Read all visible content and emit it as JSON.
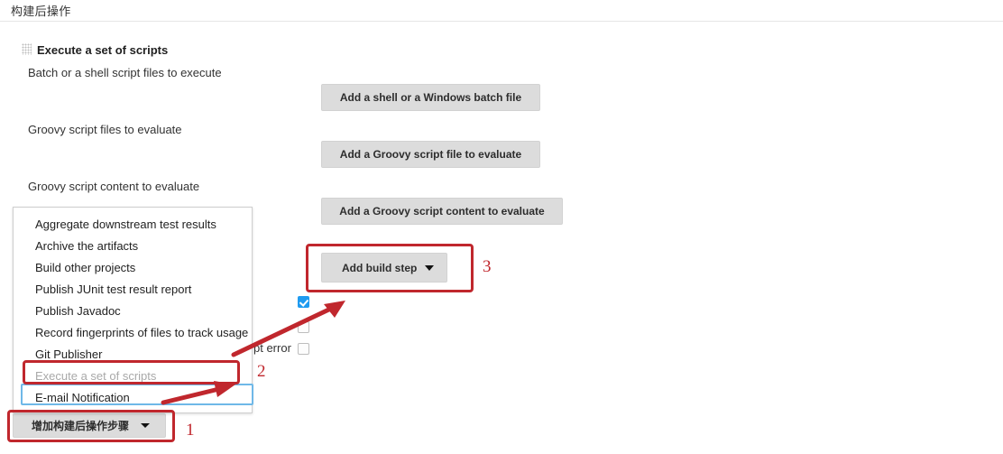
{
  "header": {
    "title": "构建后操作"
  },
  "block": {
    "title": "Execute a set of scripts",
    "grip_icon": "drag-handle-icon"
  },
  "fields": [
    {
      "label": "Batch or a shell script files to execute",
      "button": "Add a shell or a Windows batch file"
    },
    {
      "label": "Groovy script files to evaluate",
      "button": "Add a Groovy script file to evaluate"
    },
    {
      "label": "Groovy script content to evaluate",
      "button": "Add a Groovy script content to evaluate"
    }
  ],
  "add_build_step": {
    "label": "Add build step",
    "caret_icon": "chevron-down-icon"
  },
  "add_post_build_step": {
    "label": "增加构建后操作步骤",
    "caret_icon": "chevron-down-icon"
  },
  "checkboxes": [
    {
      "label": "",
      "checked": true
    },
    {
      "label": "",
      "checked": false
    },
    {
      "label": "pt error",
      "checked": false
    }
  ],
  "menu": {
    "items": [
      {
        "label": "Aggregate downstream test results",
        "state": "normal"
      },
      {
        "label": "Archive the artifacts",
        "state": "normal"
      },
      {
        "label": "Build other projects",
        "state": "normal"
      },
      {
        "label": "Publish JUnit test result report",
        "state": "normal"
      },
      {
        "label": "Publish Javadoc",
        "state": "normal"
      },
      {
        "label": "Record fingerprints of files to track usage",
        "state": "normal"
      },
      {
        "label": "Git Publisher",
        "state": "normal"
      },
      {
        "label": "Execute a set of scripts",
        "state": "disabled"
      },
      {
        "label": "E-mail Notification",
        "state": "selected"
      }
    ]
  },
  "annotations": {
    "numbers": [
      "1",
      "2",
      "3"
    ],
    "accent_red": "#c0272d",
    "accent_blue": "#6fb8e8"
  }
}
